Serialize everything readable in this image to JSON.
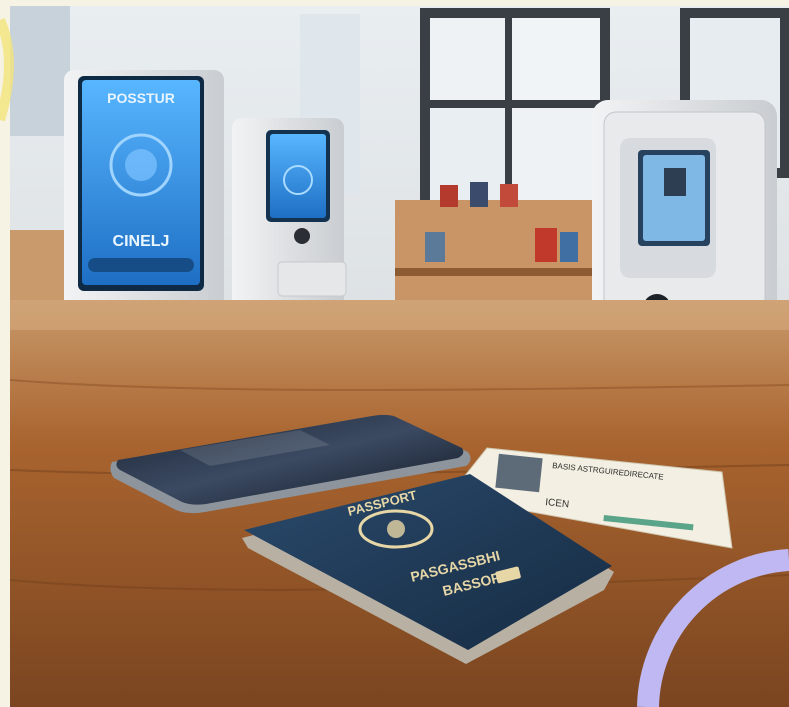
{
  "scene": {
    "kiosk_left": {
      "screen_title": "POSSTUR",
      "screen_label": "CINELJ"
    },
    "passport": {
      "top_label": "PASSPORT",
      "title_line1": "PASGASSBHI",
      "title_line2": "BASSORT"
    },
    "id_card": {
      "header": "BASIS ASTRGUIREDIRECATE",
      "field_label": "ICEN"
    }
  },
  "colors": {
    "frame": "#f6f3e4",
    "passport_cover": "#1f3a57",
    "gold": "#e7d6a6",
    "kiosk_screen": "#2e86d8",
    "wood": "#9a5a2c",
    "accent_arc": "#bfb8f2"
  }
}
